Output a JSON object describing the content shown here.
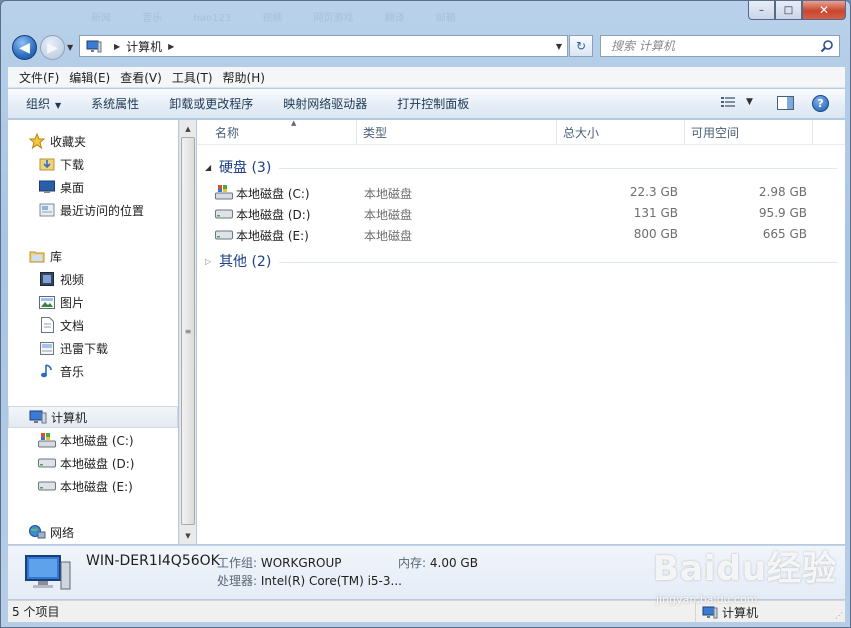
{
  "window": {
    "background_ghost": [
      "新闻",
      "音乐",
      "hao123",
      "视频",
      "网页游戏",
      "翻译",
      "邮箱"
    ],
    "controls": {
      "minimize": "–",
      "maximize": "□",
      "close": "✕"
    }
  },
  "address_bar": {
    "path": [
      "计算机"
    ],
    "search_placeholder": "搜索 计算机"
  },
  "menu": [
    "文件(F)",
    "编辑(E)",
    "查看(V)",
    "工具(T)",
    "帮助(H)"
  ],
  "commands": [
    "组织",
    "系统属性",
    "卸载或更改程序",
    "映射网络驱动器",
    "打开控制面板"
  ],
  "sidebar": {
    "favorites": {
      "label": "收藏夹",
      "items": [
        "下载",
        "桌面",
        "最近访问的位置"
      ]
    },
    "libraries": {
      "label": "库",
      "items": [
        "视频",
        "图片",
        "文档",
        "迅雷下载",
        "音乐"
      ]
    },
    "computer": {
      "label": "计算机",
      "items": [
        "本地磁盘 (C:)",
        "本地磁盘 (D:)",
        "本地磁盘 (E:)"
      ]
    },
    "network": {
      "label": "网络"
    }
  },
  "columns": {
    "name": "名称",
    "type": "类型",
    "total": "总大小",
    "free": "可用空间"
  },
  "groups": {
    "hard_disks": {
      "title": "硬盘 (3)",
      "drives": [
        {
          "name": "本地磁盘 (C:)",
          "type": "本地磁盘",
          "total": "22.3 GB",
          "free": "2.98 GB"
        },
        {
          "name": "本地磁盘 (D:)",
          "type": "本地磁盘",
          "total": "131 GB",
          "free": "95.9 GB"
        },
        {
          "name": "本地磁盘 (E:)",
          "type": "本地磁盘",
          "total": "800 GB",
          "free": "665 GB"
        }
      ]
    },
    "other": {
      "title": "其他 (2)"
    }
  },
  "details": {
    "computer_name": "WIN-DER1I4Q56OK",
    "workgroup_label": "工作组:",
    "workgroup": "WORKGROUP",
    "memory_label": "内存:",
    "memory": "4.00 GB",
    "processor_label": "处理器:",
    "processor": "Intel(R) Core(TM) i5-3..."
  },
  "status": {
    "count": "5 个项目",
    "location": "计算机"
  },
  "watermark": {
    "logo": "Baidu经验",
    "url": "jingyan.baidu.com"
  }
}
